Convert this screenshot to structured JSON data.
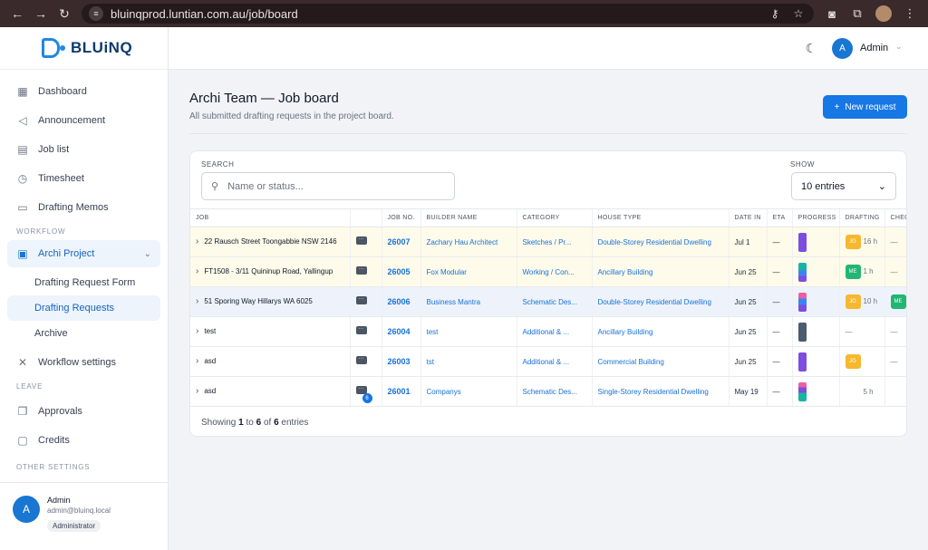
{
  "browser": {
    "url": "bluinqprod.luntian.com.au/job/board"
  },
  "brand": {
    "name": "BLUiNQ"
  },
  "sidebar": {
    "items": [
      {
        "label": "Dashboard"
      },
      {
        "label": "Announcement"
      },
      {
        "label": "Job list"
      },
      {
        "label": "Timesheet"
      },
      {
        "label": "Drafting Memos"
      }
    ],
    "workflow_label": "WORKFLOW",
    "group": {
      "label": "Archi Project"
    },
    "sub_items": [
      {
        "label": "Drafting Request Form"
      },
      {
        "label": "Drafting Requests"
      },
      {
        "label": "Archive"
      }
    ],
    "workflow_settings": "Workflow settings",
    "leave_label": "LEAVE",
    "leave_items": [
      {
        "label": "Approvals"
      },
      {
        "label": "Credits"
      }
    ],
    "other_label": "OTHER SETTINGS"
  },
  "user": {
    "initial": "A",
    "name": "Admin",
    "email": "admin@bluinq.local",
    "role": "Administrator"
  },
  "topbar": {
    "initial": "A",
    "name": "Admin"
  },
  "page": {
    "title": "Archi Team — Job board",
    "subtitle": "All submitted drafting requests in the project board.",
    "new_button": "New request"
  },
  "filters": {
    "search_label": "SEARCH",
    "search_placeholder": "Name or status...",
    "show_label": "SHOW",
    "show_value": "10 entries"
  },
  "table": {
    "headers": [
      "JOB",
      "",
      "JOB NO.",
      "BUILDER NAME",
      "CATEGORY",
      "HOUSE TYPE",
      "DATE IN",
      "ETA",
      "PROGRESS",
      "DRAFTING",
      "CHEC"
    ],
    "rows": [
      {
        "job": "22 Rausch Street Toongabbie NSW 2146",
        "job_no": "26007",
        "builder": "Zachary Hau Architect",
        "category": "Sketches / Pr...",
        "house_type": "Double-Storey Residential Dwelling",
        "date_in": "Jul 1",
        "eta": "—",
        "drafting_initials": "JG",
        "drafting_hours": "16 h",
        "check": "—"
      },
      {
        "job": "FT1508 - 3/11 Quininup Road, Yallingup",
        "job_no": "26005",
        "builder": "Fox Modular",
        "category": "Working / Con...",
        "house_type": "Ancillary Building",
        "date_in": "Jun 25",
        "eta": "—",
        "drafting_initials": "ME",
        "drafting_hours": "1 h",
        "check": "—"
      },
      {
        "job": "51 Sporing Way Hillarys WA 6025",
        "job_no": "26006",
        "builder": "Business Mantra",
        "category": "Schematic Des...",
        "house_type": "Double-Storey Residential Dwelling",
        "date_in": "Jun 25",
        "eta": "—",
        "drafting_initials": "JG",
        "drafting_hours": "10 h",
        "check": "ME"
      },
      {
        "job": "test",
        "job_no": "26004",
        "builder": "test",
        "category": "Additional & ...",
        "house_type": "Ancillary Building",
        "date_in": "Jun 25",
        "eta": "—",
        "drafting_initials": "",
        "drafting_hours": "—",
        "check": "—"
      },
      {
        "job": "asd",
        "job_no": "26003",
        "builder": "tst",
        "category": "Additional & ...",
        "house_type": "Commercial Building",
        "date_in": "Jun 25",
        "eta": "—",
        "drafting_initials": "JG",
        "drafting_hours": "",
        "check": "—"
      },
      {
        "job": "asd",
        "job_no": "26001",
        "builder": "Companys",
        "category": "Schematic Des...",
        "house_type": "Single-Storey Residential Dwelling",
        "date_in": "May 19",
        "eta": "—",
        "drafting_initials": "",
        "drafting_hours": "5 h",
        "check": "",
        "comment_count": "6"
      }
    ]
  },
  "footer": {
    "prefix": "Showing ",
    "from": "1",
    "mid": " to ",
    "to": "6",
    "of": " of ",
    "total": "6",
    "suffix": " entries"
  },
  "colors": {
    "accent": "#1677e5",
    "highlight_row": "#fffbea",
    "selected_row": "#eef3fb",
    "badge_jg": "#f5b82e",
    "badge_me": "#22b573"
  }
}
